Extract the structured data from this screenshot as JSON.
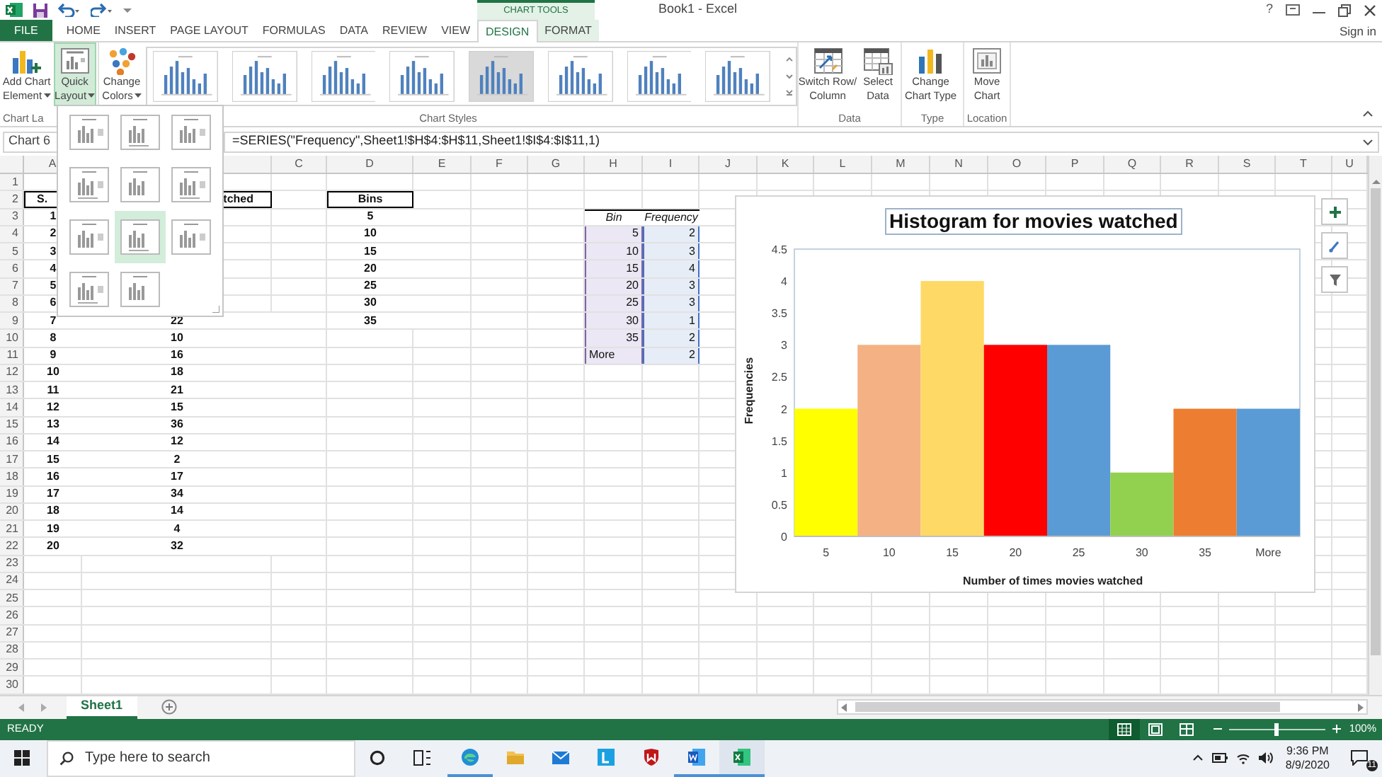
{
  "title_bar": {
    "contextual_header": "CHART TOOLS",
    "title": "Book1 - Excel",
    "help": "?"
  },
  "tabs": [
    {
      "label": "FILE",
      "kind": "file",
      "selected": false
    },
    {
      "label": "HOME",
      "kind": "normal",
      "selected": false
    },
    {
      "label": "INSERT",
      "kind": "normal",
      "selected": false
    },
    {
      "label": "PAGE LAYOUT",
      "kind": "normal",
      "selected": false
    },
    {
      "label": "FORMULAS",
      "kind": "normal",
      "selected": false
    },
    {
      "label": "DATA",
      "kind": "normal",
      "selected": false
    },
    {
      "label": "REVIEW",
      "kind": "normal",
      "selected": false
    },
    {
      "label": "VIEW",
      "kind": "normal",
      "selected": false
    },
    {
      "label": "DESIGN",
      "kind": "contextual",
      "selected": true
    },
    {
      "label": "FORMAT",
      "kind": "contextual",
      "selected": false
    }
  ],
  "account": {
    "label": "Sign in"
  },
  "ribbon": {
    "groups": [
      {
        "label": "Chart La",
        "buttons": [
          {
            "label": [
              "Add Chart",
              "Element"
            ],
            "dropdown": true,
            "selected": false
          },
          {
            "label": [
              "Quick",
              "Layout"
            ],
            "dropdown": true,
            "selected": true
          }
        ]
      },
      {
        "label": "Chart Styles",
        "buttons": [
          {
            "label": [
              "Change",
              "Colors"
            ],
            "dropdown": true,
            "selected": false
          }
        ],
        "gallery": [
          {
            "selected": false
          },
          {
            "selected": false
          },
          {
            "selected": false
          },
          {
            "selected": false
          },
          {
            "selected": true
          },
          {
            "selected": false
          },
          {
            "selected": false
          },
          {
            "selected": false
          }
        ]
      },
      {
        "label": "Data",
        "buttons": [
          {
            "label": [
              "Switch Row/",
              "Column"
            ],
            "dropdown": false,
            "selected": false
          },
          {
            "label": [
              "Select",
              "Data"
            ],
            "dropdown": false,
            "selected": false
          }
        ]
      },
      {
        "label": "Type",
        "buttons": [
          {
            "label": [
              "Change",
              "Chart Type"
            ],
            "dropdown": false,
            "selected": false
          }
        ]
      },
      {
        "label": "Location",
        "buttons": [
          {
            "label": [
              "Move",
              "Chart"
            ],
            "dropdown": false,
            "selected": false
          }
        ]
      }
    ]
  },
  "quick_layout_menu": {
    "layouts": [
      {
        "selected": false
      },
      {
        "selected": false
      },
      {
        "selected": false
      },
      {
        "selected": false
      },
      {
        "selected": false
      },
      {
        "selected": false
      },
      {
        "selected": false
      },
      {
        "selected": true
      },
      {
        "selected": false
      },
      {
        "selected": false
      },
      {
        "selected": false
      }
    ]
  },
  "formula_bar": {
    "name_box": "Chart 6",
    "formula": "=SERIES(\"Frequency\",Sheet1!$H$4:$H$11,Sheet1!$I$4:$I$11,1)"
  },
  "sheet": {
    "columns": [
      "A",
      null,
      "C",
      "D",
      "E",
      "F",
      "G",
      "H",
      "I",
      "J",
      "K",
      "L",
      "M",
      "N",
      "O",
      "P",
      "Q",
      "R",
      "S",
      "T",
      "U"
    ],
    "rows": [
      {
        "number": "1",
        "cells": []
      },
      {
        "number": "2",
        "cells": [
          {
            "text": "S.",
            "kind": "header-box-start"
          },
          {
            "text": "tched",
            "kind": "header-box-end"
          },
          null,
          {
            "text": "Bins",
            "kind": "header-box"
          }
        ]
      },
      {
        "number": "3",
        "cells": [
          {
            "text": "1",
            "kind": "bold"
          },
          null,
          null,
          {
            "text": "5",
            "kind": "bold"
          },
          null,
          null,
          null,
          {
            "text": "Bin",
            "kind": "italic-header"
          },
          {
            "text": "Frequency",
            "kind": "italic-header"
          }
        ]
      },
      {
        "number": "4",
        "cells": [
          {
            "text": "2",
            "kind": "bold"
          },
          null,
          null,
          {
            "text": "10",
            "kind": "bold"
          },
          null,
          null,
          null,
          {
            "text": "5",
            "kind": "bin"
          },
          {
            "text": "2",
            "kind": "freq"
          }
        ]
      },
      {
        "number": "5",
        "cells": [
          {
            "text": "3",
            "kind": "bold"
          },
          null,
          null,
          {
            "text": "15",
            "kind": "bold"
          },
          null,
          null,
          null,
          {
            "text": "10",
            "kind": "bin"
          },
          {
            "text": "3",
            "kind": "freq"
          }
        ]
      },
      {
        "number": "6",
        "cells": [
          {
            "text": "4",
            "kind": "bold"
          },
          null,
          null,
          {
            "text": "20",
            "kind": "bold"
          },
          null,
          null,
          null,
          {
            "text": "15",
            "kind": "bin"
          },
          {
            "text": "4",
            "kind": "freq"
          }
        ]
      },
      {
        "number": "7",
        "cells": [
          {
            "text": "5",
            "kind": "bold"
          },
          null,
          null,
          {
            "text": "25",
            "kind": "bold"
          },
          null,
          null,
          null,
          {
            "text": "20",
            "kind": "bin"
          },
          {
            "text": "3",
            "kind": "freq"
          }
        ]
      },
      {
        "number": "8",
        "cells": [
          {
            "text": "6",
            "kind": "bold"
          },
          null,
          null,
          {
            "text": "30",
            "kind": "bold"
          },
          null,
          null,
          null,
          {
            "text": "25",
            "kind": "bin"
          },
          {
            "text": "3",
            "kind": "freq"
          }
        ]
      },
      {
        "number": "9",
        "cells": [
          {
            "text": "7",
            "kind": "bold"
          },
          {
            "text": "22",
            "kind": "bold"
          },
          null,
          {
            "text": "35",
            "kind": "bold"
          },
          null,
          null,
          null,
          {
            "text": "30",
            "kind": "bin"
          },
          {
            "text": "1",
            "kind": "freq"
          }
        ]
      },
      {
        "number": "10",
        "cells": [
          {
            "text": "8",
            "kind": "bold"
          },
          {
            "text": "10",
            "kind": "bold"
          },
          null,
          null,
          null,
          null,
          null,
          {
            "text": "35",
            "kind": "bin"
          },
          {
            "text": "2",
            "kind": "freq"
          }
        ]
      },
      {
        "number": "11",
        "cells": [
          {
            "text": "9",
            "kind": "bold"
          },
          {
            "text": "16",
            "kind": "bold"
          },
          null,
          null,
          null,
          null,
          null,
          {
            "text": "More",
            "kind": "bin-text"
          },
          {
            "text": "2",
            "kind": "freq"
          }
        ]
      },
      {
        "number": "12",
        "cells": [
          {
            "text": "10",
            "kind": "bold"
          },
          {
            "text": "18",
            "kind": "bold"
          }
        ]
      },
      {
        "number": "13",
        "cells": [
          {
            "text": "11",
            "kind": "bold"
          },
          {
            "text": "21",
            "kind": "bold"
          }
        ]
      },
      {
        "number": "14",
        "cells": [
          {
            "text": "12",
            "kind": "bold"
          },
          {
            "text": "15",
            "kind": "bold"
          }
        ]
      },
      {
        "number": "15",
        "cells": [
          {
            "text": "13",
            "kind": "bold"
          },
          {
            "text": "36",
            "kind": "bold"
          }
        ]
      },
      {
        "number": "16",
        "cells": [
          {
            "text": "14",
            "kind": "bold"
          },
          {
            "text": "12",
            "kind": "bold"
          }
        ]
      },
      {
        "number": "17",
        "cells": [
          {
            "text": "15",
            "kind": "bold"
          },
          {
            "text": "2",
            "kind": "bold"
          }
        ]
      },
      {
        "number": "18",
        "cells": [
          {
            "text": "16",
            "kind": "bold"
          },
          {
            "text": "17",
            "kind": "bold"
          }
        ]
      },
      {
        "number": "19",
        "cells": [
          {
            "text": "17",
            "kind": "bold"
          },
          {
            "text": "34",
            "kind": "bold"
          }
        ]
      },
      {
        "number": "20",
        "cells": [
          {
            "text": "18",
            "kind": "bold"
          },
          {
            "text": "14",
            "kind": "bold"
          }
        ]
      },
      {
        "number": "21",
        "cells": [
          {
            "text": "19",
            "kind": "bold"
          },
          {
            "text": "4",
            "kind": "bold"
          }
        ]
      },
      {
        "number": "22",
        "cells": [
          {
            "text": "20",
            "kind": "bold"
          },
          {
            "text": "32",
            "kind": "bold"
          }
        ]
      },
      {
        "number": "23",
        "cells": []
      },
      {
        "number": "24",
        "cells": []
      },
      {
        "number": "25",
        "cells": []
      },
      {
        "number": "26",
        "cells": []
      },
      {
        "number": "27",
        "cells": []
      },
      {
        "number": "28",
        "cells": []
      },
      {
        "number": "29",
        "cells": []
      },
      {
        "number": "30",
        "cells": []
      }
    ]
  },
  "chart": {
    "chart_data": {
      "type": "bar",
      "title": "Histogram for movies watched",
      "xlabel": "Number of times movies watched",
      "ylabel": "Frequencies",
      "categories": [
        "5",
        "10",
        "15",
        "20",
        "25",
        "30",
        "35",
        "More"
      ],
      "values": [
        2,
        3,
        4,
        3,
        3,
        1,
        2,
        2
      ],
      "colors": [
        "#ffff00",
        "#f4b183",
        "#ffd966",
        "#ff0000",
        "#5b9bd5",
        "#92d050",
        "#ed7d31",
        "#5b9bd5"
      ],
      "ylim": [
        0,
        4.5
      ],
      "yticks": [
        0,
        0.5,
        1,
        1.5,
        2,
        2.5,
        3,
        3.5,
        4,
        4.5
      ]
    }
  },
  "sheet_tabs": [
    {
      "label": "Sheet1",
      "selected": true
    }
  ],
  "status_bar": {
    "status": "READY",
    "views": [
      {
        "selected": true
      },
      {
        "selected": false
      },
      {
        "selected": false
      }
    ],
    "zoom": {
      "level": 0.5,
      "reading": "100%"
    }
  },
  "taskbar": {
    "search_placeholder": "Type here to search",
    "apps": [
      {
        "running": true,
        "selected": false
      },
      {
        "running": false,
        "selected": false
      },
      {
        "running": false,
        "selected": false
      },
      {
        "running": false,
        "selected": false
      },
      {
        "running": false,
        "selected": false
      },
      {
        "running": true,
        "selected": false
      },
      {
        "running": true,
        "selected": true
      }
    ],
    "clock": {
      "time": "9:36 PM",
      "date": "8/9/2020"
    },
    "notifications": "11"
  }
}
